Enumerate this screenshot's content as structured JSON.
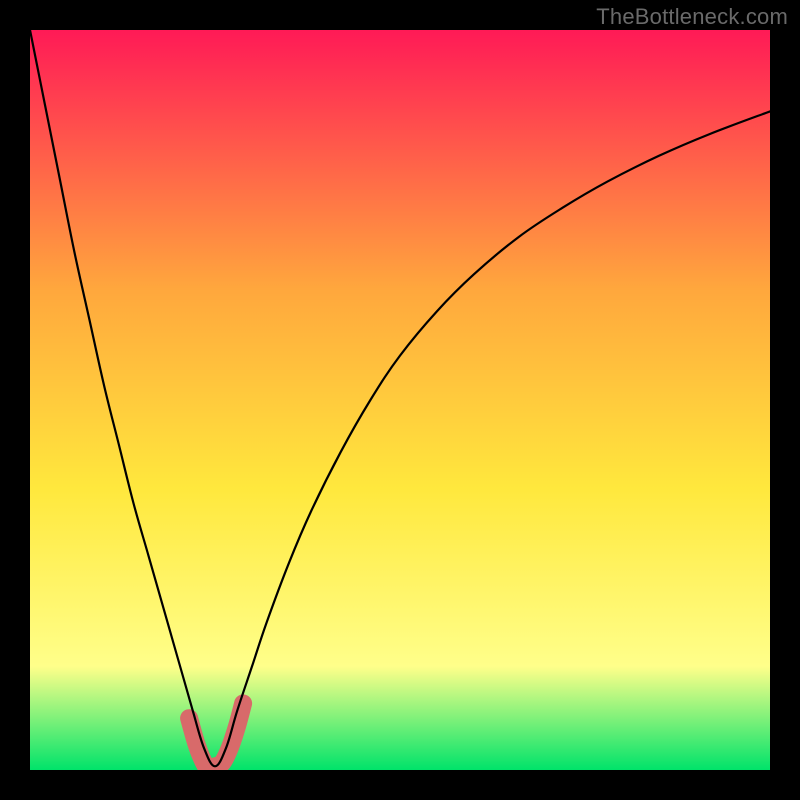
{
  "watermark": {
    "text": "TheBottleneck.com"
  },
  "colors": {
    "bg": "#000000",
    "grad_top": "#ff1a56",
    "grad_mid1": "#ffa73d",
    "grad_mid2": "#ffe83d",
    "grad_mid3": "#ffff8a",
    "grad_bottom": "#00e36a",
    "curve": "#000000",
    "highlight": "#d86a6a"
  },
  "chart_data": {
    "type": "line",
    "title": "",
    "xlabel": "",
    "ylabel": "",
    "xlim": [
      0,
      100
    ],
    "ylim": [
      0,
      100
    ],
    "series": [
      {
        "name": "bottleneck-curve",
        "x": [
          0,
          2,
          4,
          6,
          8,
          10,
          12,
          14,
          16,
          18,
          20,
          22,
          23.5,
          25,
          26.5,
          28,
          30,
          32,
          35,
          38,
          42,
          46,
          50,
          55,
          60,
          66,
          72,
          78,
          85,
          92,
          100
        ],
        "y": [
          100,
          90,
          80,
          70,
          61,
          52,
          44,
          36,
          29,
          22,
          15,
          8,
          3,
          0.5,
          3,
          8,
          14,
          20,
          28,
          35,
          43,
          50,
          56,
          62,
          67,
          72,
          76,
          79.5,
          83,
          86,
          89
        ]
      },
      {
        "name": "valley-highlight",
        "x": [
          21.5,
          22.5,
          23.5,
          24,
          25,
          26,
          27,
          28,
          28.8
        ],
        "y": [
          7,
          3.5,
          1,
          0.5,
          0.5,
          1,
          3,
          6,
          9
        ]
      }
    ],
    "annotations": []
  }
}
